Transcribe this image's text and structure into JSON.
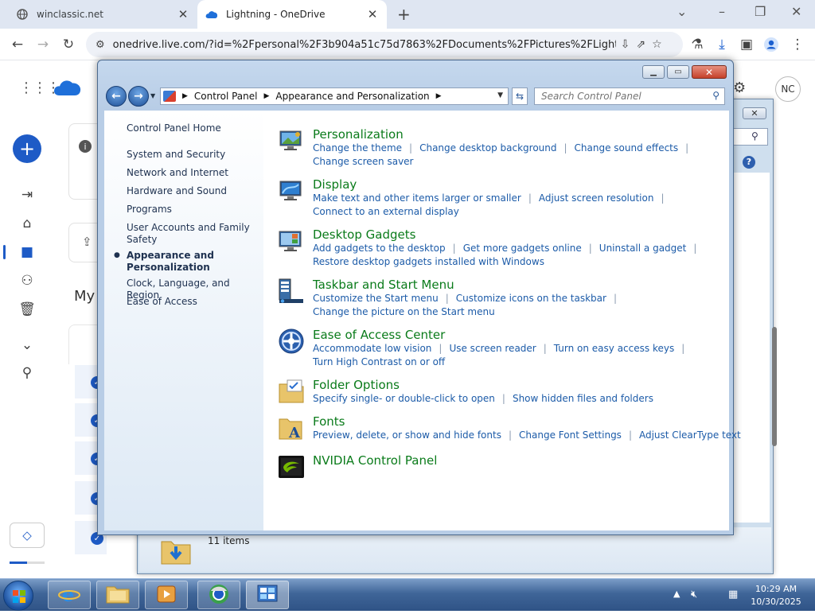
{
  "browser": {
    "tabs": [
      {
        "title": "winclassic.net",
        "active": false
      },
      {
        "title": "Lightning - OneDrive",
        "active": true
      }
    ],
    "address": "onedrive.live.com/?id=%2Fpersonal%2F3b904a51c75d7863%2FDocuments%2FPictures%2FLightning..."
  },
  "onedrive": {
    "avatar_initials": "NC",
    "my_files_partial": "My"
  },
  "explorer": {
    "status_count": "11 items"
  },
  "control_panel": {
    "breadcrumb": [
      "Control Panel",
      "Appearance and Personalization"
    ],
    "search_placeholder": "Search Control Panel",
    "left": {
      "home": "Control Panel Home",
      "categories": [
        {
          "label": "System and Security"
        },
        {
          "label": "Network and Internet"
        },
        {
          "label": "Hardware and Sound"
        },
        {
          "label": "Programs"
        },
        {
          "label": "User Accounts and Family Safety"
        },
        {
          "label": "Appearance and Personalization",
          "selected": true
        },
        {
          "label": "Clock, Language, and Region"
        },
        {
          "label": "Ease of Access"
        }
      ]
    },
    "sections": [
      {
        "title": "Personalization",
        "icon": "personalization-icon",
        "links": [
          "Change the theme",
          "Change desktop background",
          "Change sound effects",
          "Change screen saver"
        ]
      },
      {
        "title": "Display",
        "icon": "display-icon",
        "links": [
          "Make text and other items larger or smaller",
          "Adjust screen resolution",
          "Connect to an external display"
        ]
      },
      {
        "title": "Desktop Gadgets",
        "icon": "gadgets-icon",
        "links": [
          "Add gadgets to the desktop",
          "Get more gadgets online",
          "Uninstall a gadget",
          "Restore desktop gadgets installed with Windows"
        ]
      },
      {
        "title": "Taskbar and Start Menu",
        "icon": "taskbar-icon",
        "links": [
          "Customize the Start menu",
          "Customize icons on the taskbar",
          "Change the picture on the Start menu"
        ]
      },
      {
        "title": "Ease of Access Center",
        "icon": "ease-of-access-icon",
        "links": [
          "Accommodate low vision",
          "Use screen reader",
          "Turn on easy access keys",
          "Turn High Contrast on or off"
        ]
      },
      {
        "title": "Folder Options",
        "icon": "folder-options-icon",
        "links": [
          "Specify single- or double-click to open",
          "Show hidden files and folders"
        ]
      },
      {
        "title": "Fonts",
        "icon": "fonts-icon",
        "links": [
          "Preview, delete, or show and hide fonts",
          "Change Font Settings",
          "Adjust ClearType text"
        ]
      },
      {
        "title": "NVIDIA Control Panel",
        "icon": "nvidia-icon",
        "links": []
      }
    ]
  },
  "taskbar": {
    "time": "10:29 AM",
    "date": "10/30/2025"
  },
  "colors": {
    "link": "#1c5ba8",
    "section_title": "#0a7b1a",
    "onedrive_accent": "#1e5bc6"
  }
}
